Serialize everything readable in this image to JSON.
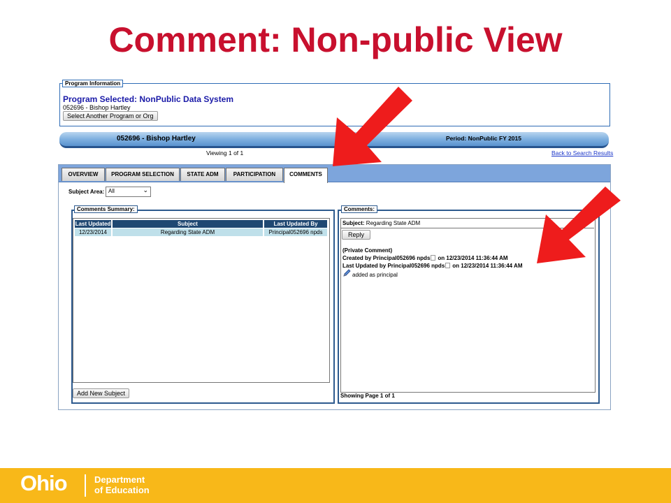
{
  "slide": {
    "title": "Comment: Non-public View"
  },
  "program_info": {
    "legend": "Program Information",
    "title": "Program Selected: NonPublic Data System",
    "subtitle": "052696 - Bishop Hartley",
    "select_button": "Select Another Program or Org"
  },
  "header_bar": {
    "org": "052696 - Bishop Hartley",
    "period": "Period: NonPublic FY 2015",
    "viewing": "Viewing 1 of 1",
    "back_link": "Back to Search Results"
  },
  "tabs": [
    {
      "label": "OVERVIEW"
    },
    {
      "label": "PROGRAM SELECTION"
    },
    {
      "label": "STATE ADM"
    },
    {
      "label": "PARTICIPATION"
    },
    {
      "label": "COMMENTS",
      "active": true
    }
  ],
  "subject_area": {
    "label": "Subject Area:",
    "value": "All"
  },
  "summary": {
    "legend": "Comments Summary:",
    "columns": [
      "Last Updated",
      "Subject",
      "Last Updated By"
    ],
    "rows": [
      [
        "12/23/2014",
        "Regarding State ADM",
        "Principal052696 npds"
      ]
    ],
    "add_button": "Add New Subject"
  },
  "comments": {
    "legend": "Comments:",
    "subject_label": "Subject:",
    "subject_value": "Regarding State ADM",
    "reply_button": "Reply",
    "private": "(Private Comment)",
    "created": "Created by Principal052696 npds",
    "created_on": "on 12/23/2014 11:36:44 AM",
    "updated": "Last Updated by Principal052696 npds",
    "updated_on": "on 12/23/2014 11:36:44 AM",
    "note": "added as principal",
    "showing": "Showing Page 1 of 1"
  },
  "footer": {
    "brand": "Ohio",
    "dept_line1": "Department",
    "dept_line2": "of Education"
  },
  "colors": {
    "title": "#c8102e",
    "arrow": "#ee1c1c",
    "footer": "#f8b819",
    "table_header": "#1f4872",
    "table_row": "#bfe0ea",
    "tabstrip": "#7da5dc"
  }
}
